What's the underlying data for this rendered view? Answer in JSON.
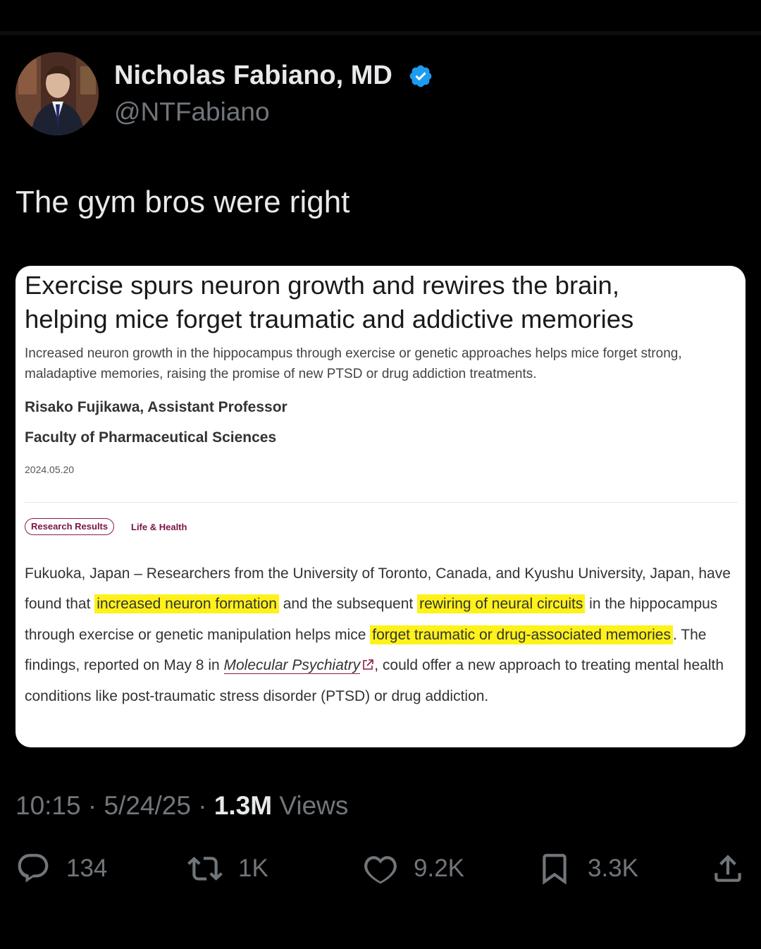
{
  "author": {
    "name": "Nicholas Fabiano, MD",
    "handle": "@NTFabiano",
    "avatar_icon": "profile-photo",
    "verified_icon": "verified-badge-icon",
    "verified_color": "#1d9bf0"
  },
  "tweet": {
    "text": "The gym bros were right"
  },
  "card": {
    "headline_line1": "Exercise spurs neuron growth and rewires the brain,",
    "headline_line2": "helping mice forget traumatic and addictive memories",
    "subhead": "Increased neuron growth in the hippocampus through exercise or genetic approaches helps mice forget strong, maladaptive memories, raising the promise of new PTSD or drug addiction treatments.",
    "author": "Risako Fujikawa, Assistant Professor",
    "faculty": "Faculty of Pharmaceutical Sciences",
    "date": "2024.05.20",
    "tags": [
      "Research Results",
      "Life & Health"
    ],
    "tag_color": "#7a1446",
    "highlight_color": "#fff21a",
    "body": {
      "p1": "Fukuoka, Japan – Researchers from the University of Toronto, Canada, and Kyushu University, Japan, have found that ",
      "h1": "increased neuron formation",
      "p2": " and the subsequent ",
      "h2": "rewiring of neural circuits",
      "p3": " in the hippocampus through exercise or genetic manipulation helps mice ",
      "h3": "forget traumatic or drug-associated memories",
      "p4": ". The findings, reported on May 8 in ",
      "link": "Molecular Psychiatry",
      "p5": ", could offer a new approach to treating mental health conditions like post-traumatic stress disorder (PTSD) or drug addiction."
    }
  },
  "meta": {
    "time": "10:15",
    "sep": "·",
    "date": "5/24/25",
    "views_count": "1.3M",
    "views_label": "Views"
  },
  "actions": {
    "replies": "134",
    "reposts": "1K",
    "likes": "9.2K",
    "bookmarks": "3.3K"
  }
}
